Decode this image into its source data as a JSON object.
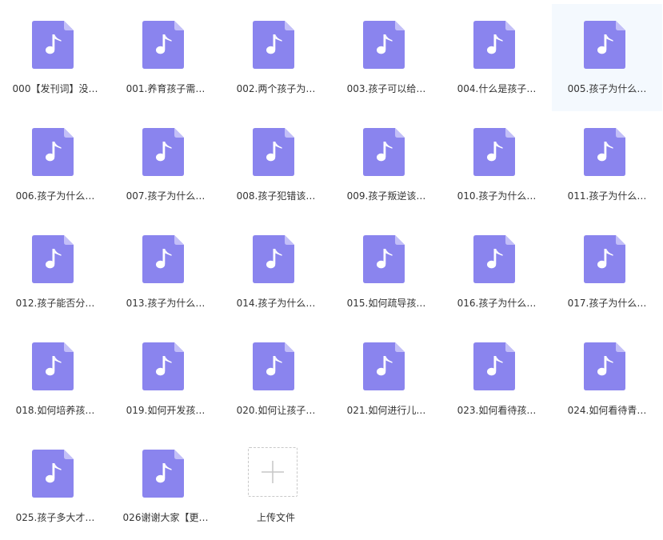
{
  "colors": {
    "file_icon": "#8a84ee",
    "file_fold": "#c3bff8",
    "note": "#ffffff",
    "selected_bg": "#f4f9fe",
    "text": "#333333",
    "upload_border": "#c9c9c9",
    "upload_plus": "#c9c9c9"
  },
  "files": [
    {
      "name": "000【发刊词】没…",
      "icon": "music-file-icon",
      "selected": false
    },
    {
      "name": "001.养育孩子需…",
      "icon": "music-file-icon",
      "selected": false
    },
    {
      "name": "002.两个孩子为…",
      "icon": "music-file-icon",
      "selected": false
    },
    {
      "name": "003.孩子可以给…",
      "icon": "music-file-icon",
      "selected": false
    },
    {
      "name": "004.什么是孩子…",
      "icon": "music-file-icon",
      "selected": false
    },
    {
      "name": "005.孩子为什么…",
      "icon": "music-file-icon",
      "selected": true
    },
    {
      "name": "006.孩子为什么…",
      "icon": "music-file-icon",
      "selected": false
    },
    {
      "name": "007.孩子为什么…",
      "icon": "music-file-icon",
      "selected": false
    },
    {
      "name": "008.孩子犯错该…",
      "icon": "music-file-icon",
      "selected": false
    },
    {
      "name": "009.孩子叛逆该…",
      "icon": "music-file-icon",
      "selected": false
    },
    {
      "name": "010.孩子为什么…",
      "icon": "music-file-icon",
      "selected": false
    },
    {
      "name": "011.孩子为什么…",
      "icon": "music-file-icon",
      "selected": false
    },
    {
      "name": "012.孩子能否分…",
      "icon": "music-file-icon",
      "selected": false
    },
    {
      "name": "013.孩子为什么…",
      "icon": "music-file-icon",
      "selected": false
    },
    {
      "name": "014.孩子为什么…",
      "icon": "music-file-icon",
      "selected": false
    },
    {
      "name": "015.如何疏导孩…",
      "icon": "music-file-icon",
      "selected": false
    },
    {
      "name": "016.孩子为什么…",
      "icon": "music-file-icon",
      "selected": false
    },
    {
      "name": "017.孩子为什么…",
      "icon": "music-file-icon",
      "selected": false
    },
    {
      "name": "018.如何培养孩…",
      "icon": "music-file-icon",
      "selected": false
    },
    {
      "name": "019.如何开发孩…",
      "icon": "music-file-icon",
      "selected": false
    },
    {
      "name": "020.如何让孩子…",
      "icon": "music-file-icon",
      "selected": false
    },
    {
      "name": "021.如何进行儿…",
      "icon": "music-file-icon",
      "selected": false
    },
    {
      "name": "023.如何看待孩…",
      "icon": "music-file-icon",
      "selected": false
    },
    {
      "name": "024.如何看待青…",
      "icon": "music-file-icon",
      "selected": false
    },
    {
      "name": "025.孩子多大才…",
      "icon": "music-file-icon",
      "selected": false
    },
    {
      "name": "026谢谢大家【更…",
      "icon": "music-file-icon",
      "selected": false
    }
  ],
  "upload": {
    "label": "上传文件",
    "icon": "plus-icon"
  }
}
